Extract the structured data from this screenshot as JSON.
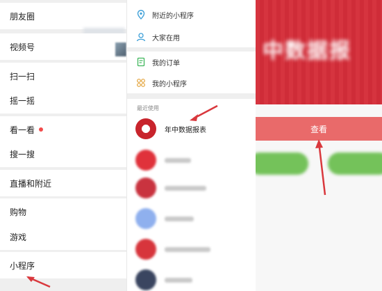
{
  "discover_menu": {
    "items": [
      "朋友圈",
      "视频号",
      "扫一扫",
      "摇一摇",
      "看一看",
      "搜一搜",
      "直播和附近",
      "购物",
      "游戏",
      "小程序"
    ]
  },
  "miniprogram_menu": {
    "items": [
      "附近的小程序",
      "大家在用",
      "我的订单",
      "我的小程序"
    ],
    "recent_header": "最近使用",
    "recent_first_label": "年中数据报表"
  },
  "detail": {
    "view_button": "查看",
    "banner_text": "中数据报"
  },
  "colors": {
    "accent_red": "#e96a6a",
    "green": "#74c25a",
    "wechat_green": "#3fb65b"
  }
}
